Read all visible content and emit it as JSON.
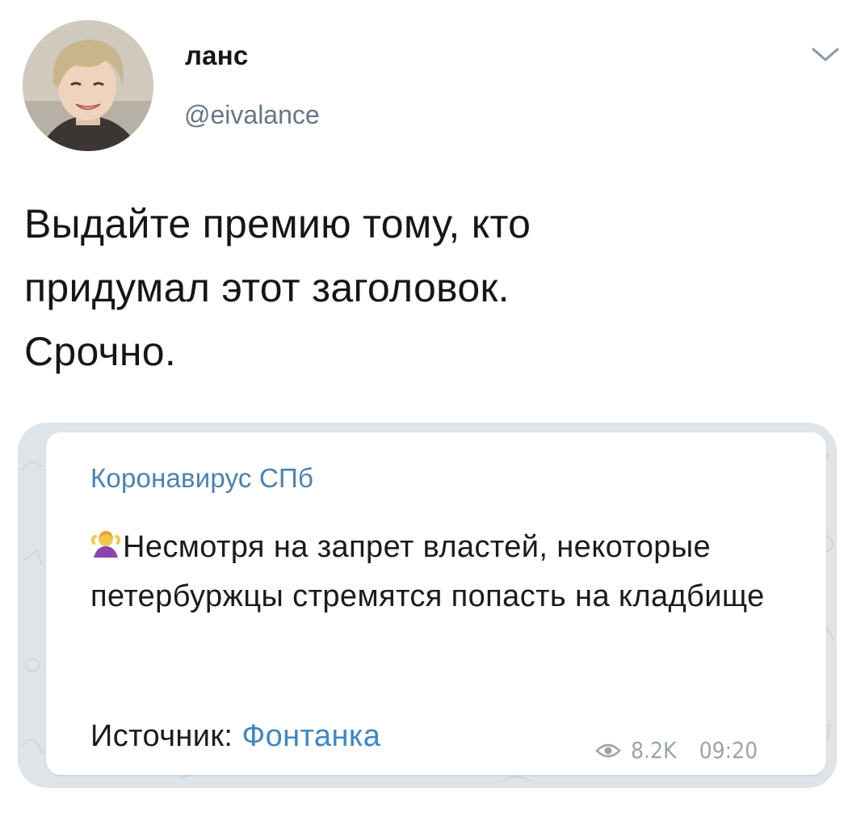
{
  "user": {
    "display_name": "ланс",
    "handle": "@eivalance"
  },
  "icons": {
    "menu": "chevron-down-icon",
    "views": "eye-icon",
    "emoji": "person-shrugging-emoji"
  },
  "tweet": {
    "text": "Выдайте премию тому, кто\nпридумал этот заголовок.\nСрочно."
  },
  "attachment": {
    "channel_name": "Коронавирус СПб",
    "message": "Несмотря на запрет властей, некоторые петербуржцы стремятся попасть на кладбище",
    "source_label": "Источник: ",
    "source_link": "Фонтанка",
    "views": "8.2K",
    "time": "09:20"
  },
  "colors": {
    "name": "#14171a",
    "handle": "#657786",
    "channel": "#4a82b4",
    "link": "#3d87c8",
    "meta": "#9ba4ad"
  }
}
